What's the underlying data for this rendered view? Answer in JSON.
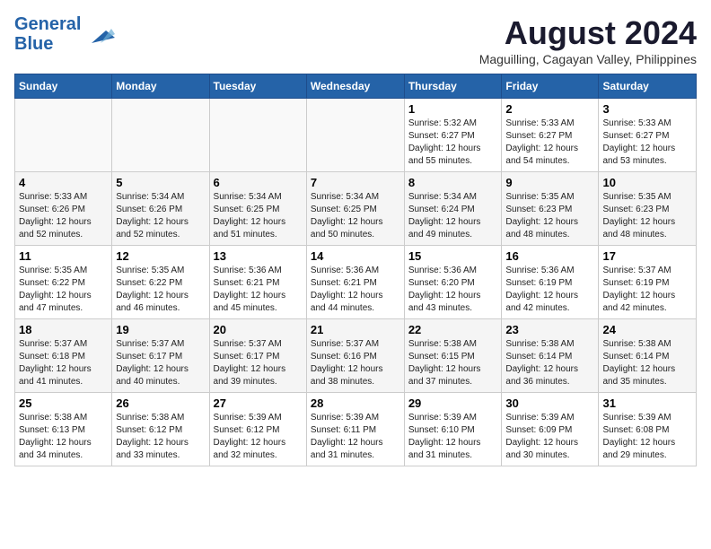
{
  "header": {
    "logo_line1": "General",
    "logo_line2": "Blue",
    "month_year": "August 2024",
    "location": "Maguilling, Cagayan Valley, Philippines"
  },
  "days_of_week": [
    "Sunday",
    "Monday",
    "Tuesday",
    "Wednesday",
    "Thursday",
    "Friday",
    "Saturday"
  ],
  "weeks": [
    [
      {
        "day": "",
        "info": ""
      },
      {
        "day": "",
        "info": ""
      },
      {
        "day": "",
        "info": ""
      },
      {
        "day": "",
        "info": ""
      },
      {
        "day": "1",
        "info": "Sunrise: 5:32 AM\nSunset: 6:27 PM\nDaylight: 12 hours\nand 55 minutes."
      },
      {
        "day": "2",
        "info": "Sunrise: 5:33 AM\nSunset: 6:27 PM\nDaylight: 12 hours\nand 54 minutes."
      },
      {
        "day": "3",
        "info": "Sunrise: 5:33 AM\nSunset: 6:27 PM\nDaylight: 12 hours\nand 53 minutes."
      }
    ],
    [
      {
        "day": "4",
        "info": "Sunrise: 5:33 AM\nSunset: 6:26 PM\nDaylight: 12 hours\nand 52 minutes."
      },
      {
        "day": "5",
        "info": "Sunrise: 5:34 AM\nSunset: 6:26 PM\nDaylight: 12 hours\nand 52 minutes."
      },
      {
        "day": "6",
        "info": "Sunrise: 5:34 AM\nSunset: 6:25 PM\nDaylight: 12 hours\nand 51 minutes."
      },
      {
        "day": "7",
        "info": "Sunrise: 5:34 AM\nSunset: 6:25 PM\nDaylight: 12 hours\nand 50 minutes."
      },
      {
        "day": "8",
        "info": "Sunrise: 5:34 AM\nSunset: 6:24 PM\nDaylight: 12 hours\nand 49 minutes."
      },
      {
        "day": "9",
        "info": "Sunrise: 5:35 AM\nSunset: 6:23 PM\nDaylight: 12 hours\nand 48 minutes."
      },
      {
        "day": "10",
        "info": "Sunrise: 5:35 AM\nSunset: 6:23 PM\nDaylight: 12 hours\nand 48 minutes."
      }
    ],
    [
      {
        "day": "11",
        "info": "Sunrise: 5:35 AM\nSunset: 6:22 PM\nDaylight: 12 hours\nand 47 minutes."
      },
      {
        "day": "12",
        "info": "Sunrise: 5:35 AM\nSunset: 6:22 PM\nDaylight: 12 hours\nand 46 minutes."
      },
      {
        "day": "13",
        "info": "Sunrise: 5:36 AM\nSunset: 6:21 PM\nDaylight: 12 hours\nand 45 minutes."
      },
      {
        "day": "14",
        "info": "Sunrise: 5:36 AM\nSunset: 6:21 PM\nDaylight: 12 hours\nand 44 minutes."
      },
      {
        "day": "15",
        "info": "Sunrise: 5:36 AM\nSunset: 6:20 PM\nDaylight: 12 hours\nand 43 minutes."
      },
      {
        "day": "16",
        "info": "Sunrise: 5:36 AM\nSunset: 6:19 PM\nDaylight: 12 hours\nand 42 minutes."
      },
      {
        "day": "17",
        "info": "Sunrise: 5:37 AM\nSunset: 6:19 PM\nDaylight: 12 hours\nand 42 minutes."
      }
    ],
    [
      {
        "day": "18",
        "info": "Sunrise: 5:37 AM\nSunset: 6:18 PM\nDaylight: 12 hours\nand 41 minutes."
      },
      {
        "day": "19",
        "info": "Sunrise: 5:37 AM\nSunset: 6:17 PM\nDaylight: 12 hours\nand 40 minutes."
      },
      {
        "day": "20",
        "info": "Sunrise: 5:37 AM\nSunset: 6:17 PM\nDaylight: 12 hours\nand 39 minutes."
      },
      {
        "day": "21",
        "info": "Sunrise: 5:37 AM\nSunset: 6:16 PM\nDaylight: 12 hours\nand 38 minutes."
      },
      {
        "day": "22",
        "info": "Sunrise: 5:38 AM\nSunset: 6:15 PM\nDaylight: 12 hours\nand 37 minutes."
      },
      {
        "day": "23",
        "info": "Sunrise: 5:38 AM\nSunset: 6:14 PM\nDaylight: 12 hours\nand 36 minutes."
      },
      {
        "day": "24",
        "info": "Sunrise: 5:38 AM\nSunset: 6:14 PM\nDaylight: 12 hours\nand 35 minutes."
      }
    ],
    [
      {
        "day": "25",
        "info": "Sunrise: 5:38 AM\nSunset: 6:13 PM\nDaylight: 12 hours\nand 34 minutes."
      },
      {
        "day": "26",
        "info": "Sunrise: 5:38 AM\nSunset: 6:12 PM\nDaylight: 12 hours\nand 33 minutes."
      },
      {
        "day": "27",
        "info": "Sunrise: 5:39 AM\nSunset: 6:12 PM\nDaylight: 12 hours\nand 32 minutes."
      },
      {
        "day": "28",
        "info": "Sunrise: 5:39 AM\nSunset: 6:11 PM\nDaylight: 12 hours\nand 31 minutes."
      },
      {
        "day": "29",
        "info": "Sunrise: 5:39 AM\nSunset: 6:10 PM\nDaylight: 12 hours\nand 31 minutes."
      },
      {
        "day": "30",
        "info": "Sunrise: 5:39 AM\nSunset: 6:09 PM\nDaylight: 12 hours\nand 30 minutes."
      },
      {
        "day": "31",
        "info": "Sunrise: 5:39 AM\nSunset: 6:08 PM\nDaylight: 12 hours\nand 29 minutes."
      }
    ]
  ]
}
